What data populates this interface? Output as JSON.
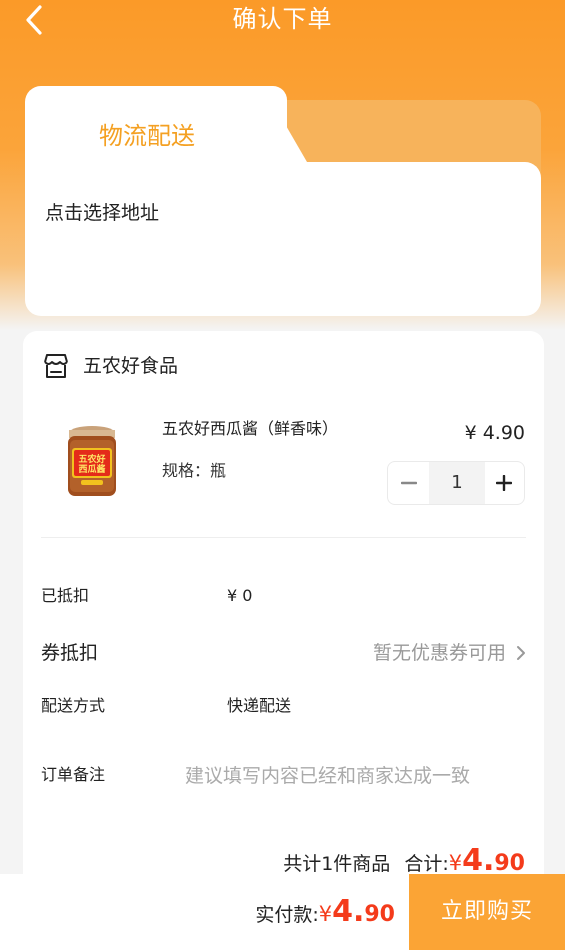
{
  "header": {
    "title": "确认下单"
  },
  "delivery": {
    "tab_label": "物流配送",
    "address_prompt": "点击选择地址"
  },
  "store": {
    "name": "五农好食品"
  },
  "product": {
    "name": "五农好西瓜酱（鲜香味）",
    "spec": "规格：瓶",
    "price": "¥ 4.90",
    "quantity": "1",
    "image_text": "五农好西瓜酱"
  },
  "details": {
    "deducted_label": "已抵扣",
    "deducted_value": "¥ 0",
    "coupon_label": "券抵扣",
    "coupon_value": "暂无优惠券可用",
    "shipping_label": "配送方式",
    "shipping_value": "快递配送",
    "remark_label": "订单备注",
    "remark_placeholder": "建议填写内容已经和商家达成一致"
  },
  "summary": {
    "count_text": "共计1件商品",
    "total_label": "合计:",
    "currency": "¥",
    "integer": "4.",
    "decimal": "90"
  },
  "bottom": {
    "pay_label": "实付款:",
    "currency": "¥",
    "integer": "4.",
    "decimal": "90",
    "buy_label": "立即购买"
  },
  "colors": {
    "accent": "#fba435",
    "price_red": "#f43b1b",
    "tab_text": "#f4a022"
  }
}
